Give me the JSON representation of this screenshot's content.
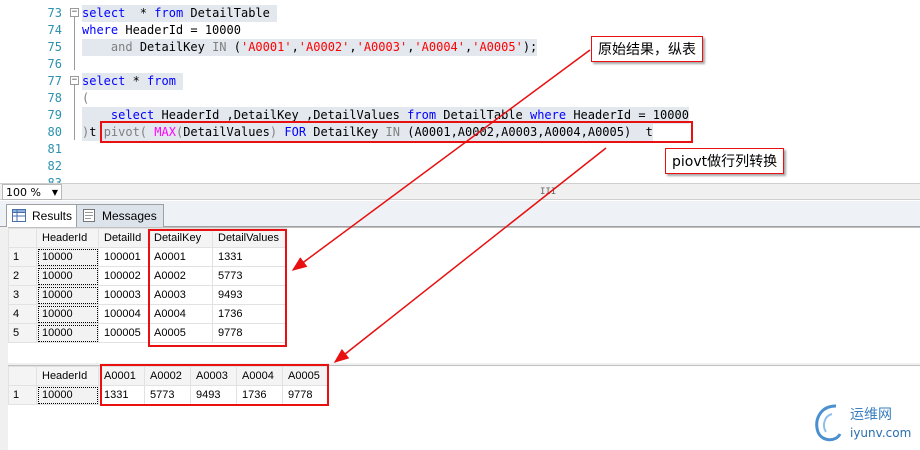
{
  "editor": {
    "lines": [
      {
        "num": "73",
        "parts": [
          [
            "kw",
            "select"
          ],
          [
            "",
            "  * "
          ],
          [
            "kw",
            "from"
          ],
          [
            "",
            " DetailTable "
          ]
        ],
        "hl": true,
        "collapse": "−"
      },
      {
        "num": "74",
        "parts": [
          [
            "kw",
            "where"
          ],
          [
            "",
            " HeaderId = 10000"
          ]
        ],
        "hl": false
      },
      {
        "num": "75",
        "parts": [
          [
            "",
            "    "
          ],
          [
            "gray",
            "and"
          ],
          [
            "",
            " DetailKey "
          ],
          [
            "gray",
            "IN"
          ],
          [
            "",
            " ("
          ],
          [
            "str",
            "'A0001'"
          ],
          [
            "",
            ","
          ],
          [
            "str",
            "'A0002'"
          ],
          [
            "",
            ","
          ],
          [
            "str",
            "'A0003'"
          ],
          [
            "",
            ","
          ],
          [
            "str",
            "'A0004'"
          ],
          [
            "",
            ","
          ],
          [
            "str",
            "'A0005'"
          ],
          [
            "",
            ");"
          ]
        ],
        "hl": true
      },
      {
        "num": "76",
        "parts": [
          [
            "",
            ""
          ]
        ],
        "hl": false
      },
      {
        "num": "77",
        "parts": [
          [
            "kw",
            "select"
          ],
          [
            "",
            " * "
          ],
          [
            "kw",
            "from"
          ],
          [
            "",
            " "
          ]
        ],
        "hl": true,
        "collapse": "−"
      },
      {
        "num": "78",
        "parts": [
          [
            "gray",
            "("
          ]
        ],
        "hl": false
      },
      {
        "num": "79",
        "parts": [
          [
            "",
            "    "
          ],
          [
            "kw",
            "select"
          ],
          [
            "",
            " HeaderId ,DetailKey ,DetailValues "
          ],
          [
            "kw",
            "from"
          ],
          [
            "",
            " DetailTable "
          ],
          [
            "kw",
            "where"
          ],
          [
            "",
            " HeaderId = 10000"
          ]
        ],
        "hl": true
      },
      {
        "num": "80",
        "parts": [
          [
            "gray",
            ")"
          ],
          [
            "",
            "t "
          ],
          [
            "gray",
            "pivot("
          ],
          [
            "",
            " "
          ],
          [
            "fn",
            "MAX"
          ],
          [
            "gray",
            "("
          ],
          [
            "",
            "DetailValues"
          ],
          [
            "gray",
            ")"
          ],
          [
            "",
            " "
          ],
          [
            "kw",
            "FOR"
          ],
          [
            "",
            " DetailKey "
          ],
          [
            "gray",
            "IN"
          ],
          [
            "",
            " (A0001,A0002,A0003,A0004,A0005)"
          ],
          [
            "",
            "  t"
          ]
        ],
        "hl": true
      },
      {
        "num": "81",
        "parts": [
          [
            "",
            ""
          ]
        ],
        "hl": false
      },
      {
        "num": "82",
        "parts": [
          [
            "",
            ""
          ]
        ],
        "hl": false
      },
      {
        "num": "83",
        "parts": [
          [
            "",
            ""
          ]
        ],
        "hl": false
      }
    ]
  },
  "zoom": {
    "value": "100 %",
    "grip": "III"
  },
  "tabs": [
    {
      "label": "Results",
      "icon": "grid-icon",
      "active": true
    },
    {
      "label": "Messages",
      "icon": "messages-icon",
      "active": false
    }
  ],
  "result1": {
    "columns": [
      "HeaderId",
      "DetailId",
      "DetailKey",
      "DetailValues"
    ],
    "rows": [
      [
        "1",
        "10000",
        "100001",
        "A0001",
        "1331"
      ],
      [
        "2",
        "10000",
        "100002",
        "A0002",
        "5773"
      ],
      [
        "3",
        "10000",
        "100003",
        "A0003",
        "9493"
      ],
      [
        "4",
        "10000",
        "100004",
        "A0004",
        "1736"
      ],
      [
        "5",
        "10000",
        "100005",
        "A0005",
        "9778"
      ]
    ]
  },
  "result2": {
    "columns": [
      "HeaderId",
      "A0001",
      "A0002",
      "A0003",
      "A0004",
      "A0005"
    ],
    "rows": [
      [
        "1",
        "10000",
        "1331",
        "5773",
        "9493",
        "1736",
        "9778"
      ]
    ]
  },
  "annotations": {
    "note1": "原始结果，纵表",
    "note2": "piovt做行列转换",
    "accent": "#e81010"
  },
  "watermark": {
    "name": "运维网",
    "domain": "iyunv.com"
  }
}
